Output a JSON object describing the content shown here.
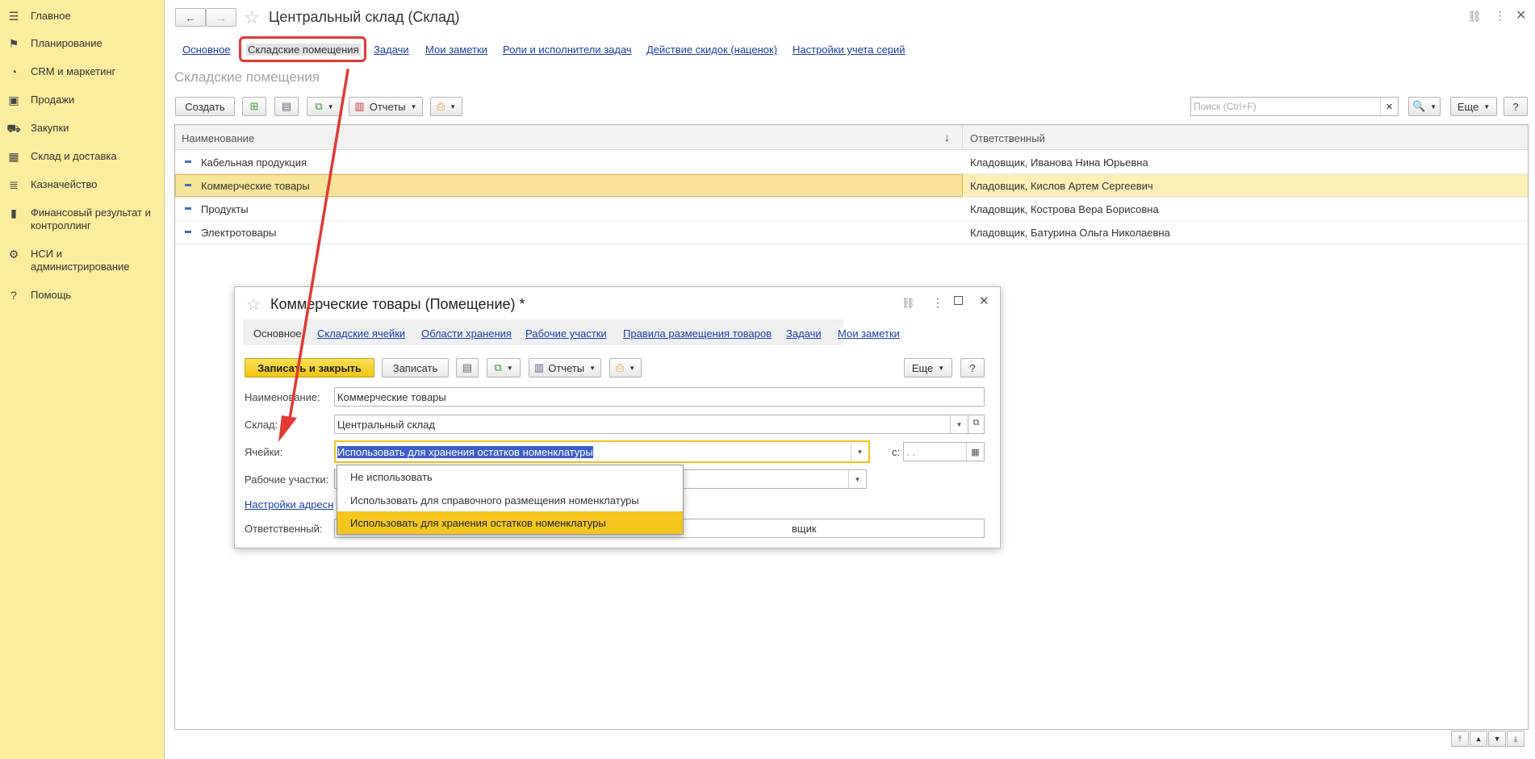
{
  "sidebar": {
    "items": [
      {
        "label": "Главное",
        "icon": "menu-icon"
      },
      {
        "label": "Планирование",
        "icon": "planning-icon"
      },
      {
        "label": "CRM и маркетинг",
        "icon": "crm-icon"
      },
      {
        "label": "Продажи",
        "icon": "sales-bag-icon"
      },
      {
        "label": "Закупки",
        "icon": "cart-icon"
      },
      {
        "label": "Склад и доставка",
        "icon": "warehouse-icon"
      },
      {
        "label": "Казначейство",
        "icon": "treasury-icon"
      },
      {
        "label": "Финансовый результат и контроллинг",
        "icon": "bar-chart-icon"
      },
      {
        "label": "НСИ и администрирование",
        "icon": "gear-icon"
      },
      {
        "label": "Помощь",
        "icon": "help-icon"
      }
    ]
  },
  "header": {
    "title": "Центральный склад (Склад)"
  },
  "tabs": [
    "Основное",
    "Складские помещения",
    "Задачи",
    "Мои заметки",
    "Роли и исполнители задач",
    "Действие скидок (наценок)",
    "Настройки учета серий"
  ],
  "section_title": "Складские помещения",
  "toolbar": {
    "create": "Создать",
    "reports": "Отчеты",
    "search_placeholder": "Поиск (Ctrl+F)",
    "more": "Еще",
    "help": "?"
  },
  "table": {
    "columns": [
      "Наименование",
      "Ответственный"
    ],
    "sort_indicator": "↓",
    "rows": [
      {
        "name": "Кабельная продукция",
        "responsible": "Кладовщик, Иванова Нина Юрьевна"
      },
      {
        "name": "Коммерческие товары",
        "responsible": "Кладовщик, Кислов Артем Сергеевич"
      },
      {
        "name": "Продукты",
        "responsible": "Кладовщик, Кострова Вера Борисовна"
      },
      {
        "name": "Электротовары",
        "responsible": "Кладовщик, Батурина Ольга Николаевна"
      }
    ]
  },
  "dialog": {
    "title": "Коммерческие товары (Помещение) *",
    "tabs": [
      "Основное",
      "Складские ячейки",
      "Области хранения",
      "Рабочие участки",
      "Правила размещения товаров",
      "Задачи",
      "Мои заметки"
    ],
    "save_close": "Записать и закрыть",
    "save": "Записать",
    "reports": "Отчеты",
    "more": "Еще",
    "help": "?",
    "fields": {
      "name_label": "Наименование:",
      "name_value": "Коммерческие товары",
      "warehouse_label": "Склад:",
      "warehouse_value": "Центральный склад",
      "cells_label": "Ячейки:",
      "cells_value": "Использовать для хранения остатков номенклатуры",
      "date_label": "с:",
      "date_value": " .  . ",
      "workareas_label": "Рабочие участки:",
      "address_link": "Настройки адресн",
      "responsible_label": "Ответственный:",
      "responsible_value_tail": "вщик"
    },
    "dropdown_options": [
      "Не использовать",
      "Использовать для справочного размещения номенклатуры",
      "Использовать для хранения остатков номенклатуры"
    ]
  },
  "colors": {
    "sidebar_bg": "#fbed9e",
    "selected_row": "#fcefb7",
    "accent_yellow": "#f5c61e",
    "link": "#1a3fa8",
    "annotation_red": "#e53935"
  }
}
